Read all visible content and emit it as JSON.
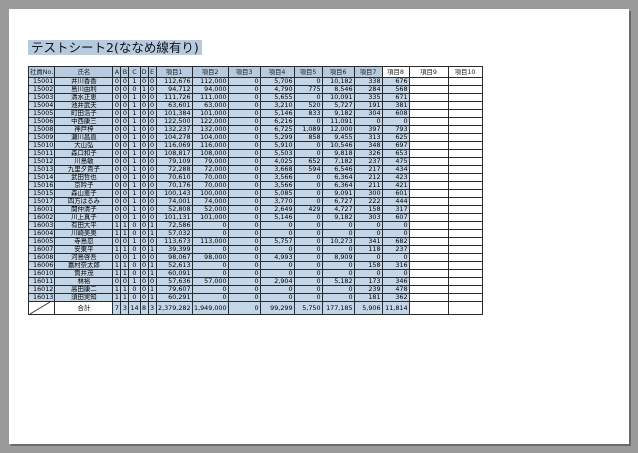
{
  "title": "テストシート2(ななめ線有り)",
  "headers": [
    "社員No.",
    "氏名",
    "A",
    "B",
    "C",
    "D",
    "E",
    "項目1",
    "項目2",
    "項目3",
    "項目4",
    "項目5",
    "項目6",
    "項目7",
    "項目8",
    "項目9",
    "項目10"
  ],
  "rows": [
    [
      "15001",
      "井川香香",
      "0",
      "0",
      "1",
      "0",
      "0",
      "112,676",
      "112,000",
      "0",
      "5,706",
      "0",
      "10,182",
      "338",
      "676",
      "",
      ""
    ],
    [
      "15002",
      "島川由利",
      "0",
      "0",
      "0",
      "1",
      "0",
      "94,712",
      "94,000",
      "0",
      "4,790",
      "775",
      "8,546",
      "284",
      "568",
      "",
      ""
    ],
    [
      "15003",
      "清水正恵",
      "0",
      "0",
      "1",
      "0",
      "0",
      "111,726",
      "111,000",
      "0",
      "5,655",
      "0",
      "10,091",
      "335",
      "671",
      "",
      ""
    ],
    [
      "15004",
      "池井武夫",
      "0",
      "0",
      "1",
      "0",
      "0",
      "63,601",
      "63,000",
      "0",
      "3,210",
      "520",
      "5,727",
      "191",
      "381",
      "",
      ""
    ],
    [
      "15005",
      "町田浩子",
      "0",
      "0",
      "1",
      "0",
      "0",
      "101,384",
      "101,000",
      "0",
      "5,146",
      "833",
      "9,182",
      "304",
      "608",
      "",
      ""
    ],
    [
      "15006",
      "中西康三",
      "0",
      "0",
      "1",
      "0",
      "0",
      "122,500",
      "122,000",
      "0",
      "6,216",
      "0",
      "11,091",
      "0",
      "0",
      "",
      ""
    ],
    [
      "15008",
      "神戸梓",
      "0",
      "0",
      "1",
      "0",
      "0",
      "132,237",
      "132,000",
      "0",
      "6,725",
      "1,089",
      "12,000",
      "397",
      "793",
      "",
      ""
    ],
    [
      "15009",
      "瀬川昌直",
      "0",
      "0",
      "1",
      "0",
      "0",
      "104,278",
      "104,000",
      "0",
      "5,299",
      "858",
      "9,455",
      "313",
      "625",
      "",
      ""
    ],
    [
      "15010",
      "大山弘",
      "0",
      "0",
      "1",
      "0",
      "0",
      "116,069",
      "116,000",
      "0",
      "5,910",
      "0",
      "10,546",
      "348",
      "697",
      "",
      ""
    ],
    [
      "15011",
      "森口和子",
      "0",
      "0",
      "1",
      "0",
      "0",
      "108,817",
      "108,000",
      "0",
      "5,503",
      "0",
      "9,818",
      "326",
      "653",
      "",
      ""
    ],
    [
      "15012",
      "川島敏",
      "0",
      "0",
      "1",
      "0",
      "0",
      "79,109",
      "79,000",
      "0",
      "4,025",
      "652",
      "7,182",
      "237",
      "475",
      "",
      ""
    ],
    [
      "15013",
      "九里夕貴子",
      "0",
      "0",
      "1",
      "0",
      "0",
      "72,288",
      "72,000",
      "0",
      "3,668",
      "594",
      "6,546",
      "217",
      "434",
      "",
      ""
    ],
    [
      "15014",
      "武田哲也",
      "0",
      "0",
      "1",
      "0",
      "0",
      "70,610",
      "70,000",
      "0",
      "3,566",
      "0",
      "6,364",
      "212",
      "423",
      "",
      ""
    ],
    [
      "15016",
      "京吟子",
      "0",
      "0",
      "1",
      "0",
      "0",
      "70,176",
      "70,000",
      "0",
      "3,566",
      "0",
      "6,364",
      "211",
      "421",
      "",
      ""
    ],
    [
      "15015",
      "森山恵子",
      "0",
      "0",
      "1",
      "0",
      "0",
      "100,143",
      "100,000",
      "0",
      "5,085",
      "0",
      "9,091",
      "300",
      "601",
      "",
      ""
    ],
    [
      "15017",
      "四方はるみ",
      "0",
      "0",
      "1",
      "0",
      "0",
      "74,001",
      "74,000",
      "0",
      "3,770",
      "0",
      "6,727",
      "222",
      "444",
      "",
      ""
    ],
    [
      "16001",
      "関仲清子",
      "0",
      "0",
      "1",
      "0",
      "0",
      "52,808",
      "52,000",
      "0",
      "2,649",
      "429",
      "4,727",
      "158",
      "317",
      "",
      ""
    ],
    [
      "16002",
      "川上真子",
      "0",
      "0",
      "1",
      "0",
      "0",
      "101,131",
      "101,000",
      "0",
      "5,146",
      "0",
      "9,182",
      "303",
      "607",
      "",
      ""
    ],
    [
      "16003",
      "有田大平",
      "1",
      "1",
      "0",
      "0",
      "1",
      "72,586",
      "0",
      "0",
      "0",
      "0",
      "0",
      "0",
      "0",
      "",
      ""
    ],
    [
      "16004",
      "川崎美奥",
      "1",
      "1",
      "0",
      "0",
      "1",
      "57,032",
      "0",
      "0",
      "0",
      "0",
      "0",
      "0",
      "0",
      "",
      ""
    ],
    [
      "16005",
      "寺島忍",
      "0",
      "0",
      "1",
      "0",
      "0",
      "113,673",
      "113,000",
      "0",
      "5,757",
      "0",
      "10,273",
      "341",
      "682",
      "",
      ""
    ],
    [
      "16007",
      "安東平",
      "1",
      "1",
      "0",
      "0",
      "1",
      "39,399",
      "0",
      "0",
      "0",
      "0",
      "0",
      "118",
      "237",
      "",
      ""
    ],
    [
      "16008",
      "河島啓吾",
      "0",
      "0",
      "1",
      "0",
      "0",
      "98,067",
      "98,000",
      "0",
      "4,993",
      "0",
      "8,909",
      "0",
      "0",
      "",
      ""
    ],
    [
      "16006",
      "嘉村奈太郎",
      "1",
      "1",
      "0",
      "0",
      "1",
      "52,613",
      "0",
      "0",
      "0",
      "0",
      "0",
      "158",
      "316",
      "",
      ""
    ],
    [
      "16010",
      "筒井茂",
      "1",
      "1",
      "0",
      "0",
      "1",
      "60,091",
      "0",
      "0",
      "0",
      "0",
      "0",
      "0",
      "0",
      "",
      ""
    ],
    [
      "16011",
      "林裕",
      "0",
      "0",
      "1",
      "0",
      "0",
      "57,636",
      "57,000",
      "0",
      "2,904",
      "0",
      "5,182",
      "173",
      "346",
      "",
      ""
    ],
    [
      "16012",
      "高田康二",
      "1",
      "1",
      "0",
      "0",
      "1",
      "79,607",
      "0",
      "0",
      "0",
      "0",
      "0",
      "239",
      "478",
      "",
      ""
    ],
    [
      "16013",
      "須田実知",
      "1",
      "1",
      "0",
      "0",
      "1",
      "60,291",
      "0",
      "0",
      "0",
      "0",
      "0",
      "181",
      "362",
      "",
      ""
    ]
  ],
  "total": {
    "label": "合計",
    "values": [
      "7",
      "3",
      "14",
      "8",
      "3",
      "2,379,282",
      "1,949,000",
      "0",
      "99,299",
      "5,750",
      "177,185",
      "5,906",
      "11,814",
      "",
      ""
    ]
  }
}
